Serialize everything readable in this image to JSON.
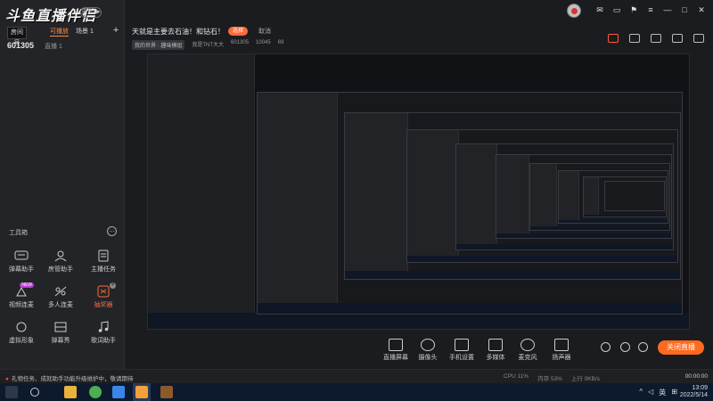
{
  "app": {
    "logo_text": "斗鱼直播伴侣",
    "logo_badge": "更新 ▶",
    "room_badge": "房间号",
    "room_number": "601305",
    "room_sub": "直播 1"
  },
  "left_tabs": [
    "可播放",
    "场景 1"
  ],
  "tools_title": "工具箱",
  "tools": [
    {
      "label": "弹幕助手",
      "icon": "danmaku-icon"
    },
    {
      "label": "房管助手",
      "icon": "room-manager-icon"
    },
    {
      "label": "主播任务",
      "icon": "task-icon"
    },
    {
      "label": "视频连麦",
      "icon": "video-link-icon",
      "tag": "NEW"
    },
    {
      "label": "多人连麦",
      "icon": "multi-link-icon"
    },
    {
      "label": "抽奖器",
      "icon": "lottery-icon"
    },
    {
      "label": "虚拟形象",
      "icon": "avatar-icon"
    },
    {
      "label": "弹幕秀",
      "icon": "danmaku-show-icon"
    },
    {
      "label": "歌词助手",
      "icon": "lyrics-icon"
    }
  ],
  "header": {
    "stream_title": "天就是主要去石油！和钻石！",
    "select_button": "选择",
    "cancel": "取消",
    "meta": [
      "我的世界 · 趣味模组",
      "我是TNT大大",
      "601305",
      "10045",
      "69"
    ]
  },
  "controls": [
    {
      "label": "直播屏幕",
      "icon": "screen-icon"
    },
    {
      "label": "摄像头",
      "icon": "camera-icon"
    },
    {
      "label": "手机设置",
      "icon": "phone-icon"
    },
    {
      "label": "多媒体",
      "icon": "media-icon"
    },
    {
      "label": "麦克风",
      "icon": "microphone-icon"
    },
    {
      "label": "扬声器",
      "icon": "speaker-icon"
    }
  ],
  "live_button": "关闭直播",
  "status": {
    "message": "礼物任务、成就助手功能升级维护中，敬请期待",
    "mid": [
      "CPU 11%",
      "内存 53%",
      "上行 0KB/s"
    ],
    "time": "00:00:00"
  },
  "taskbar": {
    "time": "13:09",
    "date": "2022/5/14",
    "lang": "英"
  },
  "colors": {
    "accent": "#ff6a1f",
    "panel": "#232428",
    "taskbar": "#0d1a2e"
  }
}
